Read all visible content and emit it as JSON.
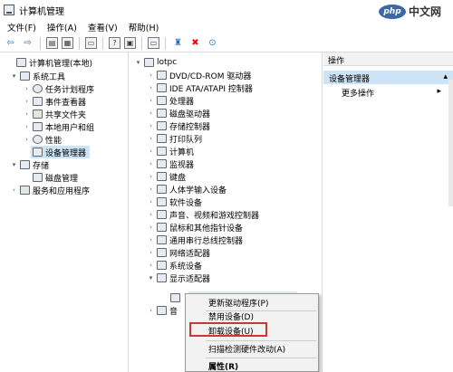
{
  "window": {
    "title": "计算机管理"
  },
  "menu": [
    "文件(F)",
    "操作(A)",
    "查看(V)",
    "帮助(H)"
  ],
  "toolbar_icons": [
    "back-arrow-icon",
    "forward-arrow-icon",
    "folder-icon",
    "console-icon",
    "properties-icon",
    "help-icon",
    "window-icon",
    "monitor-icon",
    "scan-icon",
    "remove-icon",
    "download-icon"
  ],
  "left_tree": [
    {
      "label": "计算机管理(本地)",
      "level": 0,
      "arrow": "",
      "icon": "computer-icon"
    },
    {
      "label": "系统工具",
      "level": 1,
      "arrow": "▾",
      "icon": "tools-icon"
    },
    {
      "label": "任务计划程序",
      "level": 2,
      "arrow": "›",
      "icon": "clock-icon"
    },
    {
      "label": "事件查看器",
      "level": 2,
      "arrow": "›",
      "icon": "event-icon"
    },
    {
      "label": "共享文件夹",
      "level": 2,
      "arrow": "›",
      "icon": "folder-icon"
    },
    {
      "label": "本地用户和组",
      "level": 2,
      "arrow": "›",
      "icon": "users-icon"
    },
    {
      "label": "性能",
      "level": 2,
      "arrow": "›",
      "icon": "performance-icon"
    },
    {
      "label": "设备管理器",
      "level": 2,
      "arrow": "",
      "icon": "device-manager-icon",
      "selected": true
    },
    {
      "label": "存储",
      "level": 1,
      "arrow": "▾",
      "icon": "storage-icon"
    },
    {
      "label": "磁盘管理",
      "level": 2,
      "arrow": "",
      "icon": "disk-icon"
    },
    {
      "label": "服务和应用程序",
      "level": 1,
      "arrow": "›",
      "icon": "services-icon"
    }
  ],
  "device_tree": {
    "root": "lotpc",
    "items": [
      "DVD/CD-ROM 驱动器",
      "IDE ATA/ATAPI 控制器",
      "处理器",
      "磁盘驱动器",
      "存储控制器",
      "打印队列",
      "计算机",
      "监视器",
      "键盘",
      "人体学输入设备",
      "软件设备",
      "声音、视频和游戏控制器",
      "鼠标和其他指针设备",
      "通用串行总线控制器",
      "网络适配器",
      "系统设备",
      "显示适配器"
    ],
    "partial": "音"
  },
  "actions": {
    "header": "操作",
    "section": "设备管理器",
    "more": "更多操作"
  },
  "context_menu": {
    "items": [
      "更新驱动程序(P)",
      "禁用设备(D)",
      "卸载设备(U)",
      "扫描检测硬件改动(A)",
      "属性(R)"
    ],
    "highlighted": "卸载设备(U)"
  },
  "watermark": {
    "badge": "php",
    "text": "中文网"
  }
}
